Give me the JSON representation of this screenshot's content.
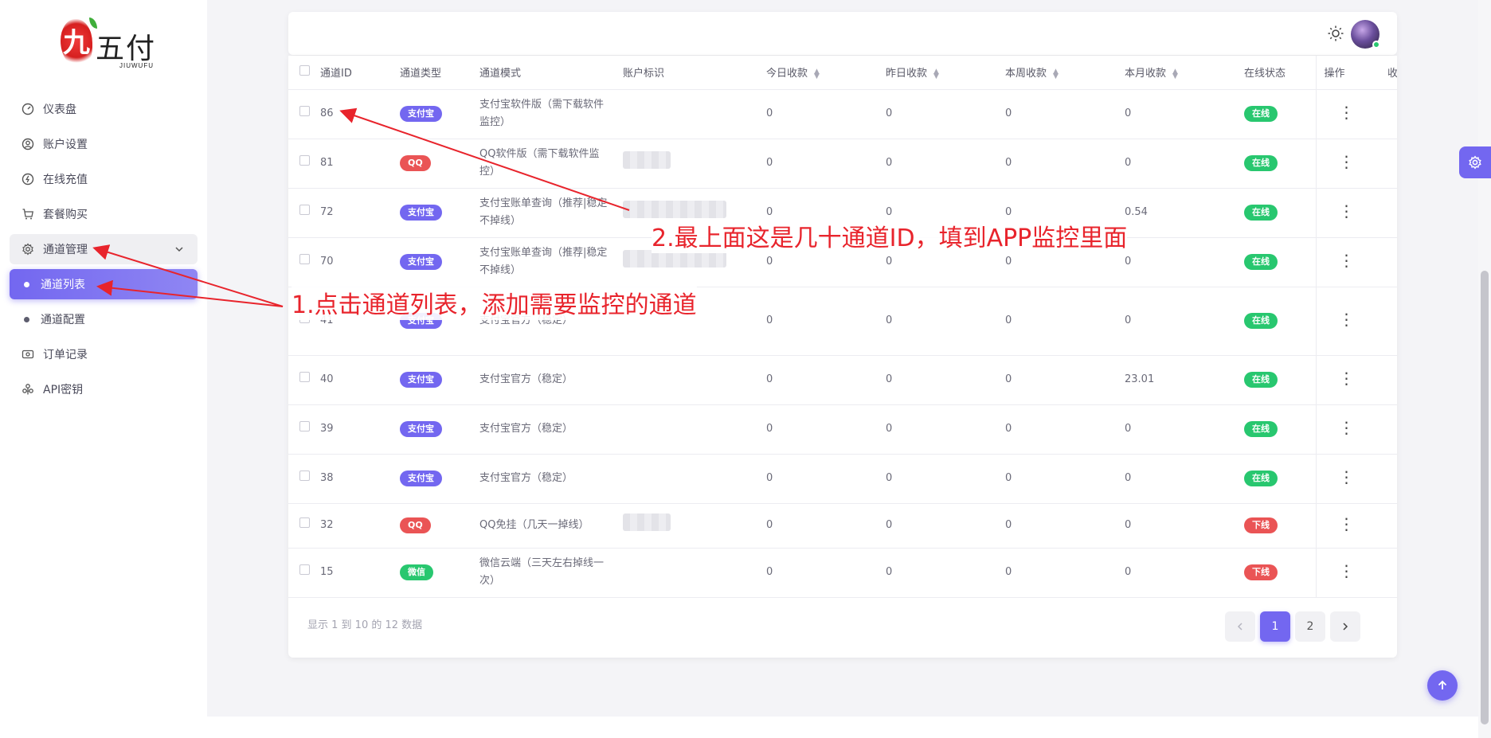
{
  "logo": {
    "mark": "九",
    "text": "五付",
    "sub": "JIUWUFU"
  },
  "nav": {
    "dashboard": "仪表盘",
    "account": "账户设置",
    "recharge": "在线充值",
    "package": "套餐购买",
    "channel_mgmt": "通道管理",
    "channel_list": "通道列表",
    "channel_config": "通道配置",
    "orders": "订单记录",
    "api_key": "API密钥"
  },
  "table": {
    "headers": {
      "id": "通道ID",
      "type": "通道类型",
      "mode": "通道模式",
      "account": "账户标识",
      "today": "今日收款",
      "yesterday": "昨日收款",
      "week": "本周收款",
      "month": "本月收款",
      "status": "在线状态",
      "actions": "操作",
      "extra": "收"
    },
    "rows": [
      {
        "id": "86",
        "type": "支付宝",
        "mode": "支付宝软件版（需下载软件监控）",
        "today": "0",
        "yesterday": "0",
        "week": "0",
        "month": "0",
        "status": "在线"
      },
      {
        "id": "81",
        "type": "QQ",
        "mode": "QQ软件版（需下载软件监控）",
        "today": "0",
        "yesterday": "0",
        "week": "0",
        "month": "0",
        "status": "在线"
      },
      {
        "id": "72",
        "type": "支付宝",
        "mode": "支付宝账单查询（推荐|稳定不掉线）",
        "today": "0",
        "yesterday": "0",
        "week": "0",
        "month": "0.54",
        "status": "在线"
      },
      {
        "id": "70",
        "type": "支付宝",
        "mode": "支付宝账单查询（推荐|稳定不掉线）",
        "today": "0",
        "yesterday": "0",
        "week": "0",
        "month": "0",
        "status": "在线"
      },
      {
        "id": "41",
        "type": "支付宝",
        "mode": "支付宝官方（稳定）",
        "today": "0",
        "yesterday": "0",
        "week": "0",
        "month": "0",
        "status": "在线"
      },
      {
        "id": "40",
        "type": "支付宝",
        "mode": "支付宝官方（稳定）",
        "today": "0",
        "yesterday": "0",
        "week": "0",
        "month": "23.01",
        "status": "在线"
      },
      {
        "id": "39",
        "type": "支付宝",
        "mode": "支付宝官方（稳定）",
        "today": "0",
        "yesterday": "0",
        "week": "0",
        "month": "0",
        "status": "在线"
      },
      {
        "id": "38",
        "type": "支付宝",
        "mode": "支付宝官方（稳定）",
        "today": "0",
        "yesterday": "0",
        "week": "0",
        "month": "0",
        "status": "在线"
      },
      {
        "id": "32",
        "type": "QQ",
        "mode": "QQ免挂（几天一掉线）",
        "today": "0",
        "yesterday": "0",
        "week": "0",
        "month": "0",
        "status": "下线"
      },
      {
        "id": "15",
        "type": "微信",
        "mode": "微信云端（三天左右掉线一次）",
        "today": "0",
        "yesterday": "0",
        "week": "0",
        "month": "0",
        "status": "下线"
      }
    ]
  },
  "footer": {
    "info": "显示 1 到 10 的 12 数据",
    "pages": [
      "1",
      "2"
    ]
  },
  "annotations": {
    "step1": "1.点击通道列表，添加需要监控的通道",
    "step2": "2.最上面这是几十通道ID，填到APP监控里面"
  },
  "colors": {
    "accent": "#7367f0",
    "alipay": "#7367f0",
    "qq": "#ea5455",
    "wechat": "#28c76f",
    "online": "#28c76f",
    "offline": "#ea5455",
    "annotation": "#e8242c"
  }
}
